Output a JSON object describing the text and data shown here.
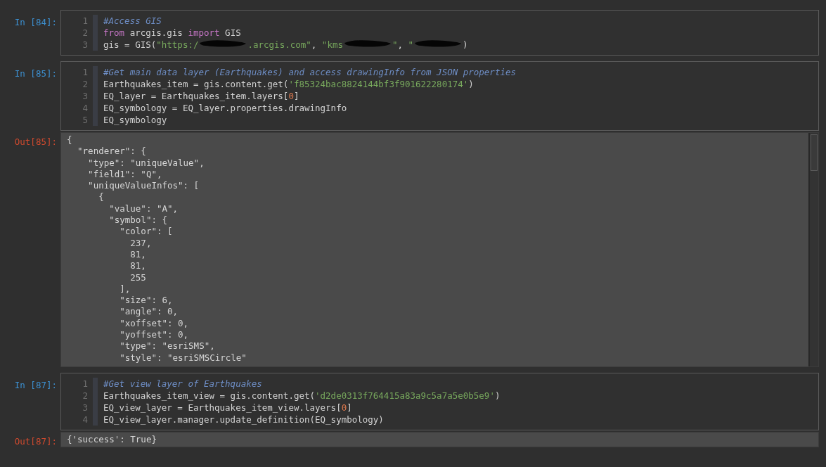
{
  "cells": [
    {
      "kind": "input",
      "prompt": "In [84]:",
      "lines": [
        {
          "no": "1",
          "tokens": [
            {
              "kind": "comment",
              "text": "#Access GIS"
            }
          ]
        },
        {
          "no": "2",
          "tokens": [
            {
              "kind": "keyword",
              "text": "from"
            },
            {
              "kind": "plain",
              "text": " arcgis.gis "
            },
            {
              "kind": "keyword",
              "text": "import"
            },
            {
              "kind": "plain",
              "text": " GIS"
            }
          ]
        },
        {
          "no": "3",
          "tokens": [
            {
              "kind": "plain",
              "text": "gis = GIS("
            },
            {
              "kind": "string",
              "text": "\"https:/"
            },
            {
              "kind": "redacted"
            },
            {
              "kind": "string",
              "text": ".arcgis.com\""
            },
            {
              "kind": "plain",
              "text": ", "
            },
            {
              "kind": "string",
              "text": "\"kms"
            },
            {
              "kind": "redacted"
            },
            {
              "kind": "string",
              "text": "\""
            },
            {
              "kind": "plain",
              "text": ", "
            },
            {
              "kind": "string",
              "text": "\""
            },
            {
              "kind": "redacted"
            },
            {
              "kind": "plain",
              "text": ")"
            }
          ]
        }
      ]
    },
    {
      "kind": "input",
      "prompt": "In [85]:",
      "lines": [
        {
          "no": "1",
          "tokens": [
            {
              "kind": "comment",
              "text": "#Get main data layer (Earthquakes) and access drawingInfo from JSON properties"
            }
          ]
        },
        {
          "no": "2",
          "tokens": [
            {
              "kind": "plain",
              "text": "Earthquakes_item = gis.content.get("
            },
            {
              "kind": "string",
              "text": "'f85324bac8824144bf3f901622280174'"
            },
            {
              "kind": "plain",
              "text": ")"
            }
          ]
        },
        {
          "no": "3",
          "tokens": [
            {
              "kind": "plain",
              "text": "EQ_layer = Earthquakes_item.layers["
            },
            {
              "kind": "number",
              "text": "0"
            },
            {
              "kind": "plain",
              "text": "]"
            }
          ]
        },
        {
          "no": "4",
          "tokens": [
            {
              "kind": "plain",
              "text": "EQ_symbology = EQ_layer.properties.drawingInfo"
            }
          ]
        },
        {
          "no": "5",
          "tokens": [
            {
              "kind": "plain",
              "text": "EQ_symbology"
            }
          ]
        }
      ]
    },
    {
      "kind": "output",
      "prompt": "Out[85]:",
      "scrolled": true,
      "lines": [
        "{",
        "  \"renderer\": {",
        "    \"type\": \"uniqueValue\",",
        "    \"field1\": \"Q\",",
        "    \"uniqueValueInfos\": [",
        "      {",
        "        \"value\": \"A\",",
        "        \"symbol\": {",
        "          \"color\": [",
        "            237,",
        "            81,",
        "            81,",
        "            255",
        "          ],",
        "          \"size\": 6,",
        "          \"angle\": 0,",
        "          \"xoffset\": 0,",
        "          \"yoffset\": 0,",
        "          \"type\": \"esriSMS\",",
        "          \"style\": \"esriSMSCircle\""
      ]
    },
    {
      "kind": "input",
      "prompt": "In [87]:",
      "lines": [
        {
          "no": "1",
          "tokens": [
            {
              "kind": "comment",
              "text": "#Get view layer of Earthquakes"
            }
          ]
        },
        {
          "no": "2",
          "tokens": [
            {
              "kind": "plain",
              "text": "Earthquakes_item_view = gis.content.get("
            },
            {
              "kind": "string",
              "text": "'d2de0313f764415a83a9c5a7a5e0b5e9'"
            },
            {
              "kind": "plain",
              "text": ")"
            }
          ]
        },
        {
          "no": "3",
          "tokens": [
            {
              "kind": "plain",
              "text": "EQ_view_layer = Earthquakes_item_view.layers["
            },
            {
              "kind": "number",
              "text": "0"
            },
            {
              "kind": "plain",
              "text": "]"
            }
          ]
        },
        {
          "no": "4",
          "tokens": [
            {
              "kind": "plain",
              "text": "EQ_view_layer.manager.update_definition(EQ_symbology)"
            }
          ]
        }
      ]
    },
    {
      "kind": "output",
      "prompt": "Out[87]:",
      "scrolled": false,
      "lines": [
        "{'success': True}"
      ]
    }
  ]
}
